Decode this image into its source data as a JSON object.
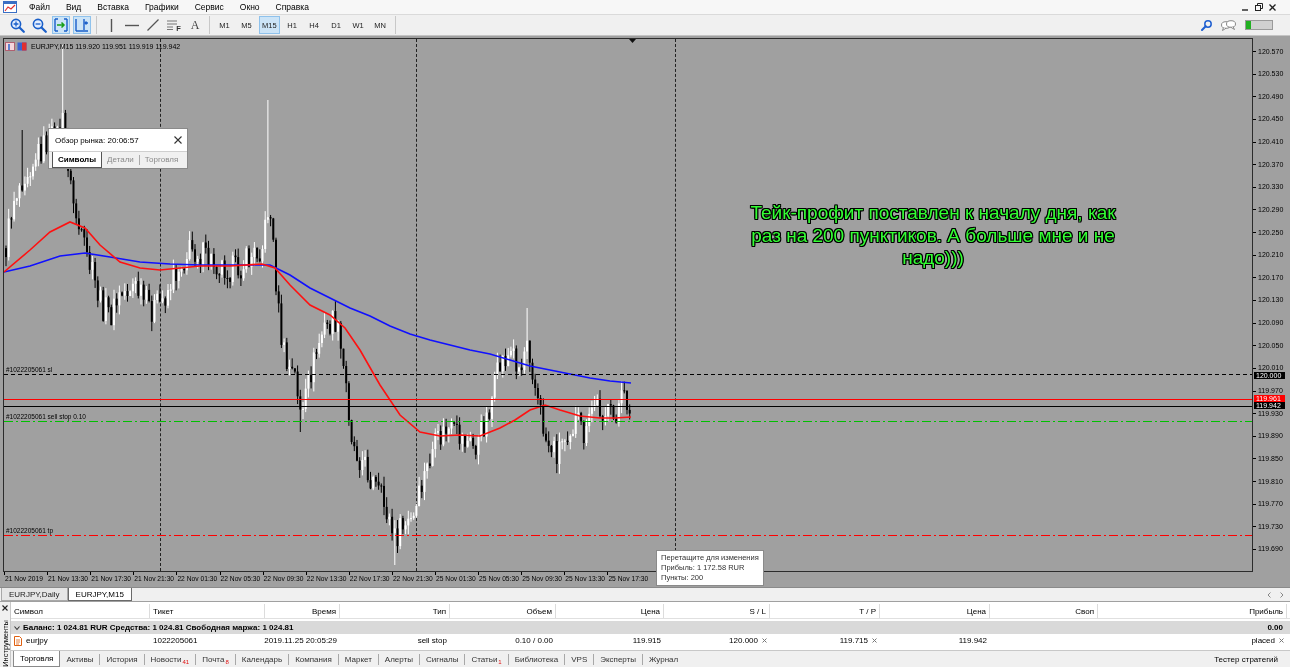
{
  "menu": [
    "Файл",
    "Вид",
    "Вставка",
    "Графики",
    "Сервис",
    "Окно",
    "Справка"
  ],
  "toolbar": {
    "view_tools": [
      {
        "kind": "zoom-in",
        "on": false
      },
      {
        "kind": "zoom-out",
        "on": false
      },
      {
        "kind": "auto-scroll",
        "on": true
      },
      {
        "kind": "chart-shift",
        "on": true
      }
    ],
    "draw_tools": [
      {
        "kind": "vertical-line"
      },
      {
        "kind": "horizontal-line"
      },
      {
        "kind": "trend-line"
      },
      {
        "kind": "fibonacci",
        "label": "F"
      },
      {
        "kind": "text",
        "label": "A"
      }
    ],
    "timeframes": [
      {
        "label": "M1",
        "selected": false
      },
      {
        "label": "M5",
        "selected": false
      },
      {
        "label": "M15",
        "selected": true
      },
      {
        "label": "H1",
        "selected": false
      },
      {
        "label": "H4",
        "selected": false
      },
      {
        "label": "D1",
        "selected": false
      },
      {
        "label": "W1",
        "selected": false
      },
      {
        "label": "MN",
        "selected": false
      }
    ]
  },
  "chart": {
    "header": "EURJPY,M15 119.920 119.951 119.919 119.942",
    "market_watch": {
      "title": "Обзор рынка: 20:06:57",
      "tabs": [
        {
          "label": "Символы",
          "selected": true
        },
        {
          "label": "Детали",
          "selected": false
        },
        {
          "label": "Торговля",
          "selected": false
        }
      ]
    },
    "note": "Тейк-профит поставлен к началу дня, как раз на 200 пунктиков. А больше мне и не надо)))",
    "order_lines": [
      {
        "kind": "stop-loss",
        "label": "#1022205061 sl",
        "color": "#000000"
      },
      {
        "kind": "pending",
        "label": "#1022205061 sell stop 0.10",
        "color": "#00c000"
      },
      {
        "kind": "take-profit",
        "label": "#1022205061 tp",
        "color": "#ff0000"
      }
    ],
    "price_axis": [
      "120.570",
      "120.530",
      "120.490",
      "120.450",
      "120.410",
      "120.370",
      "120.330",
      "120.290",
      "120.250",
      "120.210",
      "120.170",
      "120.130",
      "120.090",
      "120.050",
      "120.010",
      "119.970",
      "119.930",
      "119.890",
      "119.850",
      "119.810",
      "119.770",
      "119.730",
      "119.690"
    ],
    "price_tags": [
      {
        "kind": "stop-loss",
        "text": "120.000",
        "color": "#000000"
      },
      {
        "kind": "ask",
        "text": "119.961",
        "color": "#ff0000"
      },
      {
        "kind": "bid",
        "text": "119.942",
        "color": "#000000"
      }
    ],
    "time_axis": [
      "21 Nov 2019",
      "21 Nov 13:30",
      "21 Nov 17:30",
      "21 Nov 21:30",
      "22 Nov 01:30",
      "22 Nov 05:30",
      "22 Nov 09:30",
      "22 Nov 13:30",
      "22 Nov 17:30",
      "22 Nov 21:30",
      "25 Nov 01:30",
      "25 Nov 05:30",
      "25 Nov 09:30",
      "25 Nov 13:30",
      "25 Nov 17:30"
    ],
    "tooltip": [
      "Перетащите для изменения",
      "Прибыль: 1 172.58 RUR",
      "Пункты: 200"
    ]
  },
  "chart_tabs": [
    {
      "label": "EURJPY,Daily",
      "selected": false
    },
    {
      "label": "EURJPY,M15",
      "selected": true
    }
  ],
  "terminal": {
    "side_label": "Инструменты",
    "columns": [
      "Символ",
      "Тикет",
      "Время",
      "Тип",
      "Объем",
      "Цена",
      "S / L",
      "T / P",
      "Цена",
      "Своп",
      "Прибыль"
    ],
    "balance": {
      "expanded": true,
      "text": "Баланс: 1 024.81 RUR Средства: 1 024.81 Свободная маржа: 1 024.81",
      "profit": "0.00"
    },
    "orders": [
      {
        "symbol": "eurjpy",
        "ticket": "1022205061",
        "time": "2019.11.25 20:05:29",
        "type": "sell stop",
        "volume": "0.10 / 0.00",
        "price": "119.915",
        "sl": "120.000",
        "tp": "119.715",
        "current_price": "119.942",
        "profit": "placed"
      }
    ],
    "tabs": [
      {
        "label": "Торговля",
        "selected": true
      },
      {
        "label": "Активы",
        "selected": false
      },
      {
        "label": "История",
        "selected": false
      },
      {
        "label": "Новости",
        "badge": "41",
        "selected": false
      },
      {
        "label": "Почта",
        "badge": "8",
        "selected": false
      },
      {
        "label": "Календарь",
        "selected": false
      },
      {
        "label": "Компания",
        "selected": false
      },
      {
        "label": "Маркет",
        "selected": false
      },
      {
        "label": "Алерты",
        "selected": false
      },
      {
        "label": "Сигналы",
        "selected": false
      },
      {
        "label": "Статьи",
        "badge": "1",
        "selected": false
      },
      {
        "label": "Библиотека",
        "selected": false
      },
      {
        "label": "VPS",
        "selected": false
      },
      {
        "label": "Эксперты",
        "selected": false
      },
      {
        "label": "Журнал",
        "selected": false
      }
    ],
    "tester": "Тестер стратегий"
  }
}
